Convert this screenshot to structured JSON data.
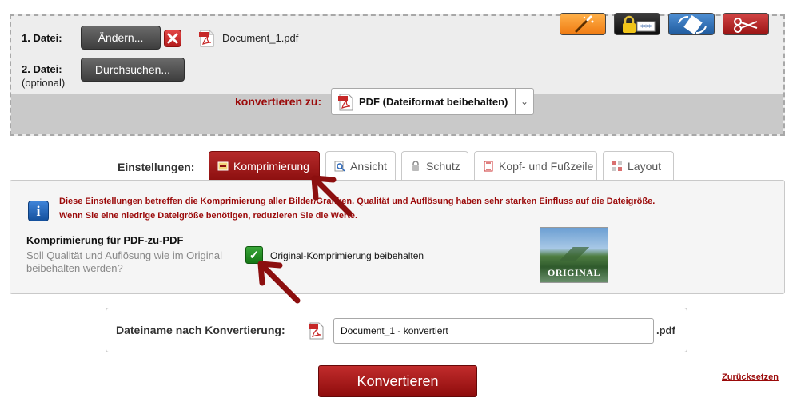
{
  "upload": {
    "file1_label": "1. Datei:",
    "change_button": "Ändern...",
    "file1_name": "Document_1.pdf",
    "file2_label": "2. Datei:",
    "file2_optional": "(optional)",
    "browse_button": "Durchsuchen..."
  },
  "tools": [
    "magic-wand-icon",
    "lock-password-icon",
    "rotate-icon",
    "scissors-icon"
  ],
  "convert": {
    "label": "konvertieren zu:",
    "format_value": "PDF (Dateiformat beibehalten)"
  },
  "settings": {
    "label": "Einstellungen:",
    "tabs": [
      {
        "label": "Komprimierung",
        "active": true
      },
      {
        "label": "Ansicht",
        "active": false
      },
      {
        "label": "Schutz",
        "active": false
      },
      {
        "label": "Kopf- und Fußzeile",
        "active": false
      },
      {
        "label": "Layout",
        "active": false
      }
    ],
    "info_line1": "Diese Einstellungen betreffen die Komprimierung aller Bilder/Grafiken. Qualität und Auflösung haben sehr starken Einfluss auf die Dateigröße.",
    "info_line2": "Wenn Sie eine niedrige Dateigröße benötigen, reduzieren Sie die Werte.",
    "compression_title": "Komprimierung für PDF-zu-PDF",
    "compression_desc": "Soll Qualität und Auflösung wie im Original beibehalten werden?",
    "checkbox_label": "Original-Komprimierung beibehalten",
    "checkbox_checked": true,
    "preview_caption": "ORIGINAL"
  },
  "output": {
    "filename_label": "Dateiname nach Konvertierung:",
    "filename_value": "Document_1 - konvertiert",
    "extension": ".pdf"
  },
  "actions": {
    "convert_button": "Konvertieren",
    "reset_link": "Zurücksetzen"
  },
  "colors": {
    "accent_red": "#9b0a0a",
    "checkbox_green": "#167716"
  }
}
